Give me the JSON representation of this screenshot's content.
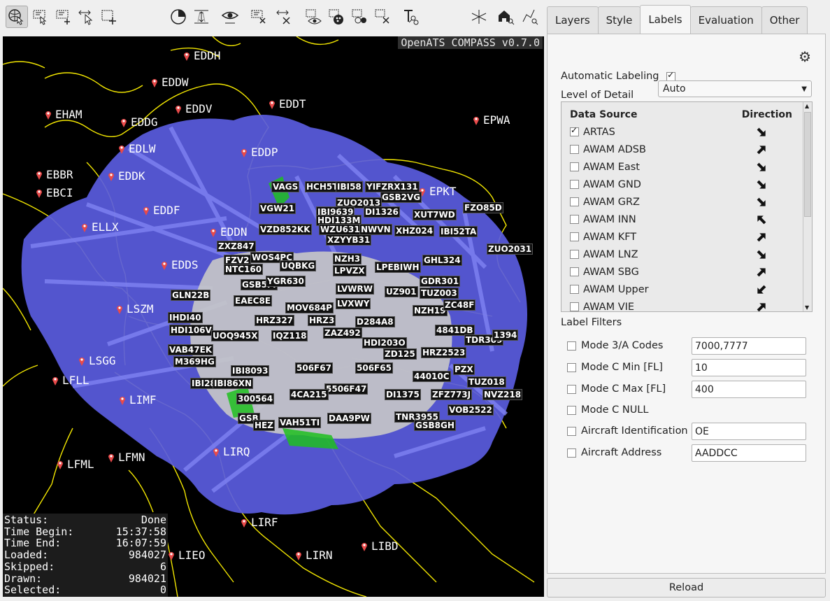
{
  "toolbar": {
    "buttons": [
      "navigate-icon",
      "select-data-icon",
      "add-selection-icon",
      "select-cursor-icon",
      "add-geometry-icon",
      "timeline-icon",
      "altitude-filter-icon",
      "view-icon",
      "clear-filters-icon",
      "clear-selection-icon",
      "eye-icon",
      "color-palette-icon",
      "cluster-icon",
      "delete-icon",
      "label-tool-icon",
      "3d-view-icon",
      "home-zoom-icon",
      "zoom-to-selection-icon"
    ]
  },
  "map": {
    "version": "OpenATS COMPASS v0.7.0",
    "airports": [
      {
        "code": "EDDH"
      },
      {
        "code": "EDDW"
      },
      {
        "code": "EHAM"
      },
      {
        "code": "EDDV"
      },
      {
        "code": "EDDT"
      },
      {
        "code": "EDDG"
      },
      {
        "code": "EPWA"
      },
      {
        "code": "EDLW"
      },
      {
        "code": "EDDP"
      },
      {
        "code": "EBBR"
      },
      {
        "code": "EDDK"
      },
      {
        "code": "EBCI"
      },
      {
        "code": "EPKT"
      },
      {
        "code": "EDDF"
      },
      {
        "code": "ELLX"
      },
      {
        "code": "EDDN"
      },
      {
        "code": "EDDS"
      },
      {
        "code": "LSZM"
      },
      {
        "code": "LSGG"
      },
      {
        "code": "LFLL"
      },
      {
        "code": "LIMF"
      },
      {
        "code": "LIRQ"
      },
      {
        "code": "LFML"
      },
      {
        "code": "LFMN"
      },
      {
        "code": "LIRF"
      },
      {
        "code": "LIBD"
      },
      {
        "code": "LIEO"
      },
      {
        "code": "LIRN"
      }
    ],
    "status": {
      "status": {
        "label": "Status:",
        "value": "Done"
      },
      "time_begin": {
        "label": "Time Begin:",
        "value": "15:37:58"
      },
      "time_end": {
        "label": "Time End:",
        "value": "16:07:59"
      },
      "loaded": {
        "label": "Loaded:",
        "value": "984027"
      },
      "skipped": {
        "label": "Skipped:",
        "value": "6"
      },
      "drawn": {
        "label": "Drawn:",
        "value": "984021"
      },
      "selected": {
        "label": "Selected:",
        "value": "0"
      }
    },
    "tags": [
      "VAGS",
      "HCH5T",
      "IBI58",
      "YIFZRX131",
      "GSB2VG",
      "VGW21",
      "ZUO2013",
      "IBI9639",
      "HDI133M",
      "DI1326",
      "XUT7WD",
      "IBI52TA",
      "FZO85D",
      "VZD852KK",
      "WZU631",
      "NWVN",
      "XHZ024",
      "XZYYB31",
      "NZH3",
      "LPVZX",
      "LPEBIWH",
      "ZUO2031",
      "ZXZ847",
      "FZV2",
      "WOS4PC",
      "NTC160",
      "UQBKG",
      "GHL324",
      "GDR301",
      "TUZ003",
      "GSB5FI",
      "GLN22B",
      "EAEC8E",
      "YGR630",
      "LVWRW",
      "UZ901",
      "HRZ327",
      "HRZ3",
      "D284A8",
      "NZH19",
      "ZC48F",
      "IHDI40",
      "HDI106V",
      "4841DB",
      "TDR309",
      "1394",
      "VAB47EK",
      "IQZ118",
      "ZAZ492",
      "HDI203O",
      "ZD125",
      "HRZ2523",
      "UOQ945X",
      "M369HG",
      "IBI8093",
      "506F67",
      "506F65",
      "PZX",
      "IBI28",
      "IBI86XN",
      "44010C",
      "TUZ018",
      "5506F47",
      "DI1375",
      "ZFZ773J",
      "NVZ218",
      "300564",
      "4CA215",
      "DAA9PW",
      "TNR3955",
      "VOB2522",
      "GSB",
      "HEZ",
      "VAH51TI",
      "GSB8GH",
      "LVXWY",
      "MOV684P"
    ]
  },
  "side": {
    "tabs": [
      "Layers",
      "Style",
      "Labels",
      "Evaluation",
      "Other"
    ],
    "active_tab": "Labels",
    "automatic_labeling": "Automatic Labeling",
    "level_of_detail": "Level of Detail",
    "level_value": "Auto",
    "ds_header": "Data Source",
    "dir_header": "Direction",
    "sources": [
      {
        "name": "ARTAS",
        "checked": true,
        "dir": "se"
      },
      {
        "name": "AWAM ADSB",
        "checked": false,
        "dir": "ne"
      },
      {
        "name": "AWAM East",
        "checked": false,
        "dir": "se"
      },
      {
        "name": "AWAM GND",
        "checked": false,
        "dir": "se"
      },
      {
        "name": "AWAM GRZ",
        "checked": false,
        "dir": "se"
      },
      {
        "name": "AWAM INN",
        "checked": false,
        "dir": "nw"
      },
      {
        "name": "AWAM KFT",
        "checked": false,
        "dir": "ne"
      },
      {
        "name": "AWAM LNZ",
        "checked": false,
        "dir": "se"
      },
      {
        "name": "AWAM SBG",
        "checked": false,
        "dir": "ne"
      },
      {
        "name": "AWAM Upper",
        "checked": false,
        "dir": "sw"
      },
      {
        "name": "AWAM VIE",
        "checked": false,
        "dir": "ne"
      }
    ],
    "label_filters": "Label Filters",
    "filters": [
      {
        "label": "Mode 3/A Codes",
        "value": "7000,7777"
      },
      {
        "label": "Mode C Min [FL]",
        "value": "10"
      },
      {
        "label": "Mode C Max [FL]",
        "value": "400"
      },
      {
        "label": "Mode C NULL",
        "value": null
      },
      {
        "label": "Aircraft Identification",
        "value": "OE"
      },
      {
        "label": "Aircraft Address",
        "value": "AADDCC"
      }
    ],
    "reload": "Reload"
  }
}
